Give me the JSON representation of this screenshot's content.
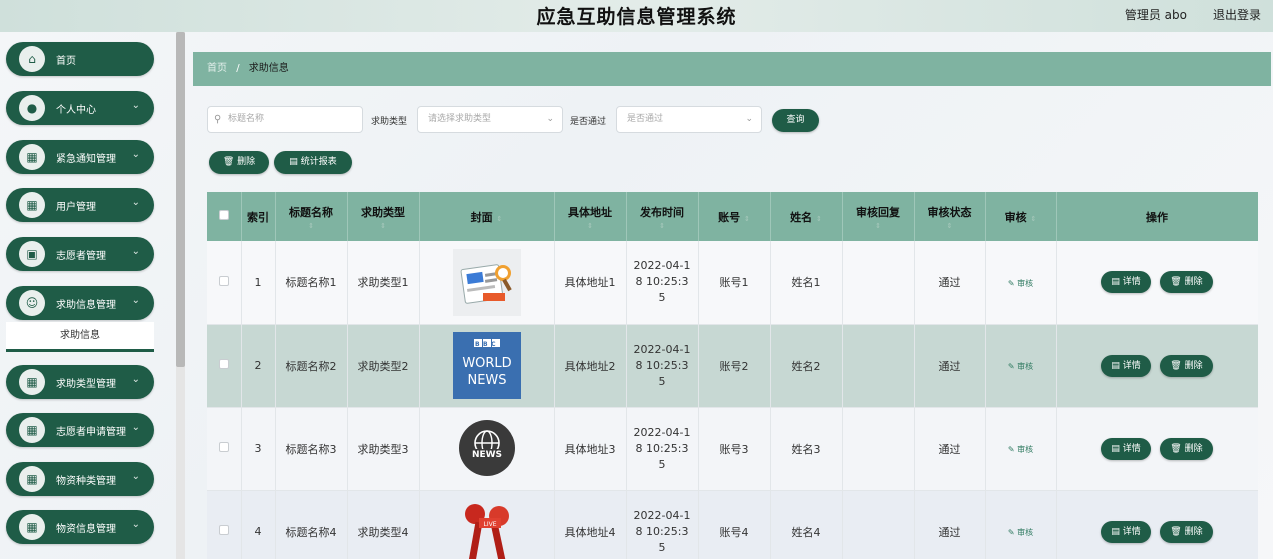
{
  "header": {
    "title": "应急互助信息管理系统",
    "admin": "管理员 abo",
    "logout": "退出登录"
  },
  "sidebar": {
    "items": [
      {
        "label": "首页",
        "icon": "home-icon"
      },
      {
        "label": "个人中心",
        "icon": "user-icon"
      },
      {
        "label": "紧急通知管理",
        "icon": "grid-icon"
      },
      {
        "label": "用户管理",
        "icon": "grid-icon"
      },
      {
        "label": "志愿者管理",
        "icon": "clipboard-icon"
      },
      {
        "label": "求助信息管理",
        "icon": "person-icon"
      },
      {
        "label": "求助类型管理",
        "icon": "grid-icon"
      },
      {
        "label": "志愿者申请管理",
        "icon": "grid-icon"
      },
      {
        "label": "物资种类管理",
        "icon": "grid-icon"
      },
      {
        "label": "物资信息管理",
        "icon": "grid-icon"
      }
    ],
    "sub_item": "求助信息"
  },
  "breadcrumb": {
    "home": "首页",
    "separator": "/",
    "current": "求助信息"
  },
  "filters": {
    "title_placeholder": "标题名称",
    "type_label": "求助类型",
    "type_placeholder": "请选择求助类型",
    "pass_label": "是否通过",
    "pass_placeholder": "是否通过",
    "query_button": "查询"
  },
  "toolbar": {
    "delete_button": "删除",
    "report_button": "统计报表"
  },
  "table": {
    "columns": [
      "索引",
      "标题名称",
      "求助类型",
      "封面",
      "具体地址",
      "发布时间",
      "账号",
      "姓名",
      "审核回复",
      "审核状态",
      "审核",
      "操作"
    ],
    "rows": [
      {
        "index": "1",
        "title": "标题名称1",
        "type": "求助类型1",
        "cover": "news-cover",
        "address": "具体地址1",
        "time": "2022-04-18 10:25:35",
        "account": "账号1",
        "name": "姓名1",
        "reply": "",
        "status": "通过",
        "audit": "审核"
      },
      {
        "index": "2",
        "title": "标题名称2",
        "type": "求助类型2",
        "cover": "bbc-cover",
        "address": "具体地址2",
        "time": "2022-04-18 10:25:35",
        "account": "账号2",
        "name": "姓名2",
        "reply": "",
        "status": "通过",
        "audit": "审核"
      },
      {
        "index": "3",
        "title": "标题名称3",
        "type": "求助类型3",
        "cover": "globe-cover",
        "address": "具体地址3",
        "time": "2022-04-18 10:25:35",
        "account": "账号3",
        "name": "姓名3",
        "reply": "",
        "status": "通过",
        "audit": "审核"
      },
      {
        "index": "4",
        "title": "标题名称4",
        "type": "求助类型4",
        "cover": "mic-cover",
        "address": "具体地址4",
        "time": "2022-04-18 10:25:35",
        "account": "账号4",
        "name": "姓名4",
        "reply": "",
        "status": "通过",
        "audit": "审核"
      }
    ],
    "detail_button": "详情",
    "delete_button": "删除"
  },
  "cover_text": {
    "bbc": "BBC",
    "world": "WORLD",
    "news": "NEWS",
    "live": "LIVE"
  },
  "colors": {
    "primary": "#1f5c47",
    "header_bg": "#7fb3a1",
    "accent": "#2f7a60"
  }
}
